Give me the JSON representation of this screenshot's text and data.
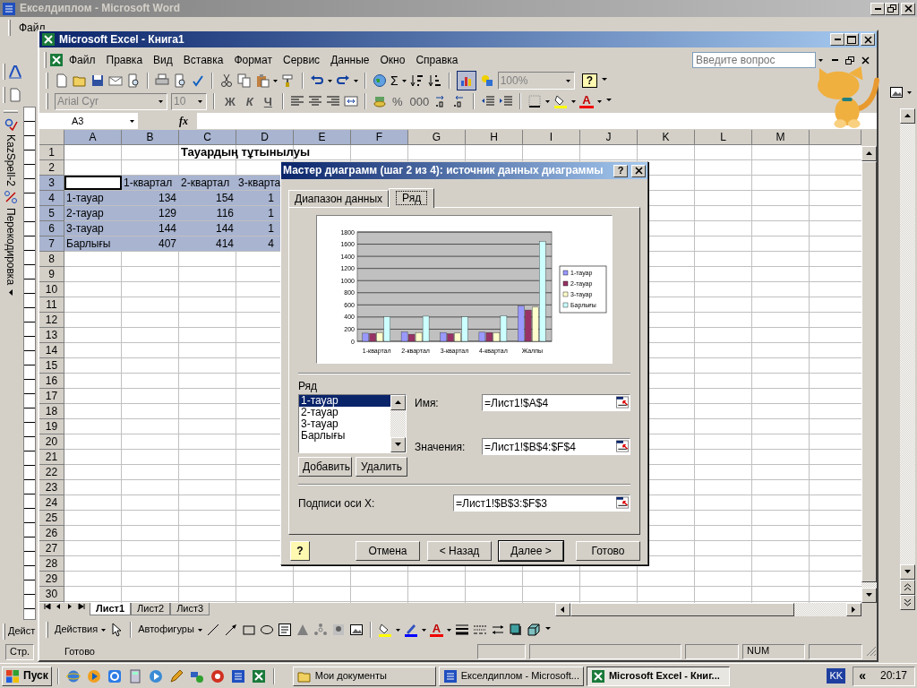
{
  "word_window": {
    "title": "Екселдиплом - Microsoft Word",
    "menu": [
      "Файл"
    ],
    "side_toolbar": [
      {
        "label": "KazSpell-2"
      },
      {
        "label": "Перекодировка"
      }
    ],
    "drawing_toolbar": "Дейст",
    "status_bar": "Стр."
  },
  "excel_window": {
    "title": "Microsoft Excel - Книга1",
    "menu": [
      "Файл",
      "Правка",
      "Вид",
      "Вставка",
      "Формат",
      "Сервис",
      "Данные",
      "Окно",
      "Справка"
    ],
    "question_box": {
      "placeholder": "Введите вопрос"
    },
    "standard_toolbar": {
      "sum": "Σ",
      "zoom": "100%",
      "help": "?",
      "chart_wizard_pressed": true
    },
    "formatting_toolbar": {
      "font": "Arial Cyr",
      "size": "10",
      "style_buttons": [
        "Ж",
        "К",
        "Ч"
      ],
      "number_buttons": [
        "%",
        "000"
      ],
      "font_color": "A"
    },
    "formula_bar": {
      "name_box": "A3",
      "fx": "fx"
    },
    "sheet": {
      "columns": [
        {
          "label": "A",
          "selected": true
        },
        {
          "label": "B",
          "selected": true
        },
        {
          "label": "C",
          "selected": true
        },
        {
          "label": "D",
          "selected": true
        },
        {
          "label": "E",
          "selected": true
        },
        {
          "label": "F",
          "selected": true
        },
        {
          "label": "G",
          "selected": false
        },
        {
          "label": "H",
          "selected": false
        },
        {
          "label": "I",
          "selected": false
        },
        {
          "label": "J",
          "selected": false
        },
        {
          "label": "K",
          "selected": false
        },
        {
          "label": "L",
          "selected": false
        },
        {
          "label": "M",
          "selected": false
        }
      ],
      "rows": [
        {
          "number": "1",
          "selected": false,
          "cells": [
            {
              "kind": "blank"
            },
            {
              "kind": "blank"
            },
            {
              "kind": "title",
              "text": "Тауардың тұтынылуы"
            }
          ]
        },
        {
          "number": "2",
          "selected": false
        },
        {
          "number": "3",
          "selected": true,
          "cells": [
            {
              "kind": "active"
            },
            {
              "kind": "text",
              "text": "1-квартал"
            },
            {
              "kind": "text",
              "text": "2-квартал"
            },
            {
              "kind": "text",
              "text": "3-кварта"
            }
          ]
        },
        {
          "number": "4",
          "selected": true,
          "cells": [
            {
              "kind": "text",
              "text": "1-тауар"
            },
            {
              "kind": "number",
              "text": "134"
            },
            {
              "kind": "number",
              "text": "154"
            },
            {
              "kind": "partial",
              "text": "1"
            }
          ]
        },
        {
          "number": "5",
          "selected": true,
          "cells": [
            {
              "kind": "text",
              "text": "2-тауар"
            },
            {
              "kind": "number",
              "text": "129"
            },
            {
              "kind": "number",
              "text": "116"
            },
            {
              "kind": "partial",
              "text": "1"
            }
          ]
        },
        {
          "number": "6",
          "selected": true,
          "cells": [
            {
              "kind": "text",
              "text": "3-тауар"
            },
            {
              "kind": "number",
              "text": "144"
            },
            {
              "kind": "number",
              "text": "144"
            },
            {
              "kind": "partial",
              "text": "1"
            }
          ]
        },
        {
          "number": "7",
          "selected": true,
          "cells": [
            {
              "kind": "text",
              "text": "Барлығы"
            },
            {
              "kind": "number",
              "text": "407"
            },
            {
              "kind": "number",
              "text": "414"
            },
            {
              "kind": "partial",
              "text": "4"
            }
          ]
        },
        {
          "number": "8",
          "selected": false
        },
        {
          "number": "9",
          "selected": false
        },
        {
          "number": "10",
          "selected": false
        },
        {
          "number": "11",
          "selected": false
        },
        {
          "number": "12",
          "selected": false
        },
        {
          "number": "13",
          "selected": false
        },
        {
          "number": "14",
          "selected": false
        },
        {
          "number": "15",
          "selected": false
        },
        {
          "number": "16",
          "selected": false
        },
        {
          "number": "17",
          "selected": false
        },
        {
          "number": "18",
          "selected": false
        },
        {
          "number": "19",
          "selected": false
        },
        {
          "number": "20",
          "selected": false
        },
        {
          "number": "21",
          "selected": false
        },
        {
          "number": "22",
          "selected": false
        },
        {
          "number": "23",
          "selected": false
        },
        {
          "number": "24",
          "selected": false
        },
        {
          "number": "25",
          "selected": false
        },
        {
          "number": "26",
          "selected": false
        },
        {
          "number": "27",
          "selected": false
        },
        {
          "number": "28",
          "selected": false
        },
        {
          "number": "29",
          "selected": false
        },
        {
          "number": "30",
          "selected": false
        }
      ]
    },
    "sheet_tabs": [
      {
        "label": "Лист1",
        "selected": true
      },
      {
        "label": "Лист2",
        "selected": false
      },
      {
        "label": "Лист3",
        "selected": false
      }
    ],
    "drawing_toolbar": {
      "actions": "Действия",
      "autoshapes": "Автофигуры",
      "font_color": "A"
    },
    "status_bar": {
      "status": "Готово",
      "indicator": "NUM"
    }
  },
  "dialog": {
    "title": "Мастер диаграмм (шаг 2 из 4): источник данных диаграммы",
    "help_button": "?",
    "tabs": [
      {
        "label": "Диапазон данных",
        "selected": false
      },
      {
        "label": "Ряд",
        "selected": true
      }
    ],
    "preview": {
      "chart_data": {
        "type": "bar",
        "categories": [
          "1-квартал",
          "2-квартал",
          "3-квартал",
          "4-квартал",
          "Жалпы"
        ],
        "series": [
          {
            "name": "1-тауар",
            "color": "#9999ff",
            "values": [
              134,
              154,
              145,
              150,
              583
            ]
          },
          {
            "name": "2-тауар",
            "color": "#993366",
            "values": [
              129,
              116,
              125,
              145,
              515
            ]
          },
          {
            "name": "3-тауар",
            "color": "#ffffcc",
            "values": [
              144,
              144,
              135,
              140,
              563
            ]
          },
          {
            "name": "Барлығы",
            "color": "#ccffff",
            "values": [
              407,
              414,
              405,
              420,
              1646
            ]
          }
        ],
        "ylim": [
          0,
          1800
        ],
        "yticks": [
          0,
          200,
          400,
          600,
          800,
          1000,
          1200,
          1400,
          1600,
          1800
        ],
        "grid": true,
        "legend": "right"
      }
    },
    "series_label": "Ряд",
    "series": [
      {
        "label": "1-тауар",
        "selected": true
      },
      {
        "label": "2-тауар",
        "selected": false
      },
      {
        "label": "3-тауар",
        "selected": false
      },
      {
        "label": "Барлығы",
        "selected": false
      }
    ],
    "series_buttons": [
      "Добавить",
      "Удалить"
    ],
    "fields": [
      {
        "label": "Имя:",
        "value": "=Лист1!$A$4"
      },
      {
        "label": "Значения:",
        "value": "=Лист1!$B$4:$F$4"
      }
    ],
    "x_labels": {
      "label": "Подписи оси X:",
      "value": "=Лист1!$B$3:$F$3"
    },
    "footer_help": "?",
    "buttons": [
      {
        "label": "Отмена",
        "default": false
      },
      {
        "label": "< Назад",
        "default": false
      },
      {
        "label": "Далее >",
        "default": true
      },
      {
        "label": "Готово",
        "default": false
      }
    ]
  },
  "taskbar": {
    "start": "Пуск",
    "tasks": [
      {
        "label": "Мои документы",
        "selected": false
      },
      {
        "label": "Екселдиплом - Microsoft...",
        "selected": false
      },
      {
        "label": "Microsoft Excel - Книг...",
        "selected": true
      }
    ],
    "language": "KK",
    "tray_toggle": "«",
    "clock": "20:17"
  }
}
